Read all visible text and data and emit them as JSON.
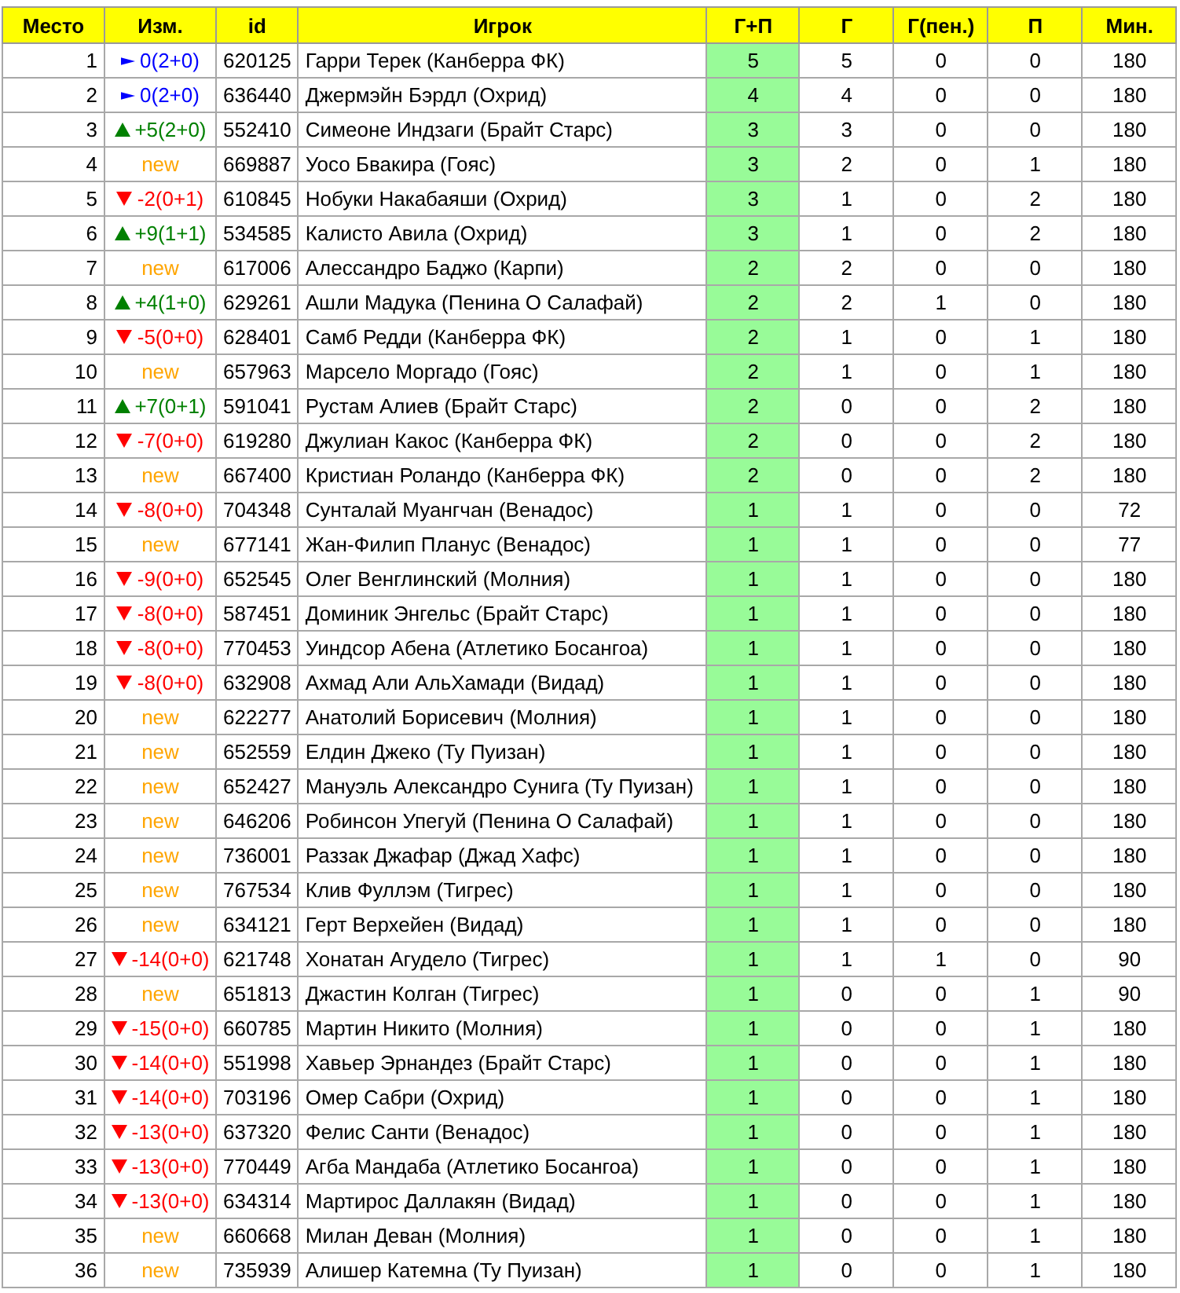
{
  "table": {
    "columns": [
      "Место",
      "Изм.",
      "id",
      "Игрок",
      "Г+П",
      "Г",
      "Г(пен.)",
      "П",
      "Мин."
    ],
    "rows": [
      {
        "place": "1",
        "change": {
          "kind": "same",
          "text": "0(2+0)"
        },
        "id": "620125",
        "player": "Гарри Терек (Канберра ФК)",
        "gp": "5",
        "g": "5",
        "pen": "0",
        "p": "0",
        "min": "180"
      },
      {
        "place": "2",
        "change": {
          "kind": "same",
          "text": "0(2+0)"
        },
        "id": "636440",
        "player": "Джермэйн Бэрдл (Охрид)",
        "gp": "4",
        "g": "4",
        "pen": "0",
        "p": "0",
        "min": "180"
      },
      {
        "place": "3",
        "change": {
          "kind": "up",
          "text": "+5(2+0)"
        },
        "id": "552410",
        "player": "Симеоне Индзаги (Брайт Старс)",
        "gp": "3",
        "g": "3",
        "pen": "0",
        "p": "0",
        "min": "180"
      },
      {
        "place": "4",
        "change": {
          "kind": "new",
          "text": "new"
        },
        "id": "669887",
        "player": "Уосо Бвакира (Гояс)",
        "gp": "3",
        "g": "2",
        "pen": "0",
        "p": "1",
        "min": "180"
      },
      {
        "place": "5",
        "change": {
          "kind": "down",
          "text": "-2(0+1)"
        },
        "id": "610845",
        "player": "Нобуки Накабаяши (Охрид)",
        "gp": "3",
        "g": "1",
        "pen": "0",
        "p": "2",
        "min": "180"
      },
      {
        "place": "6",
        "change": {
          "kind": "up",
          "text": "+9(1+1)"
        },
        "id": "534585",
        "player": "Калисто Авила (Охрид)",
        "gp": "3",
        "g": "1",
        "pen": "0",
        "p": "2",
        "min": "180"
      },
      {
        "place": "7",
        "change": {
          "kind": "new",
          "text": "new"
        },
        "id": "617006",
        "player": "Алессандро Баджо (Карпи)",
        "gp": "2",
        "g": "2",
        "pen": "0",
        "p": "0",
        "min": "180"
      },
      {
        "place": "8",
        "change": {
          "kind": "up",
          "text": "+4(1+0)"
        },
        "id": "629261",
        "player": "Ашли Мадука (Пенина О Салафай)",
        "gp": "2",
        "g": "2",
        "pen": "1",
        "p": "0",
        "min": "180"
      },
      {
        "place": "9",
        "change": {
          "kind": "down",
          "text": "-5(0+0)"
        },
        "id": "628401",
        "player": "Самб Редди (Канберра ФК)",
        "gp": "2",
        "g": "1",
        "pen": "0",
        "p": "1",
        "min": "180"
      },
      {
        "place": "10",
        "change": {
          "kind": "new",
          "text": "new"
        },
        "id": "657963",
        "player": "Марсело Моргадо (Гояс)",
        "gp": "2",
        "g": "1",
        "pen": "0",
        "p": "1",
        "min": "180"
      },
      {
        "place": "11",
        "change": {
          "kind": "up",
          "text": "+7(0+1)"
        },
        "id": "591041",
        "player": "Рустам Алиев (Брайт Старс)",
        "gp": "2",
        "g": "0",
        "pen": "0",
        "p": "2",
        "min": "180"
      },
      {
        "place": "12",
        "change": {
          "kind": "down",
          "text": "-7(0+0)"
        },
        "id": "619280",
        "player": "Джулиан Какос (Канберра ФК)",
        "gp": "2",
        "g": "0",
        "pen": "0",
        "p": "2",
        "min": "180"
      },
      {
        "place": "13",
        "change": {
          "kind": "new",
          "text": "new"
        },
        "id": "667400",
        "player": "Кристиан Роландо (Канберра ФК)",
        "gp": "2",
        "g": "0",
        "pen": "0",
        "p": "2",
        "min": "180"
      },
      {
        "place": "14",
        "change": {
          "kind": "down",
          "text": "-8(0+0)"
        },
        "id": "704348",
        "player": "Сунталай Муангчан (Венадос)",
        "gp": "1",
        "g": "1",
        "pen": "0",
        "p": "0",
        "min": "72"
      },
      {
        "place": "15",
        "change": {
          "kind": "new",
          "text": "new"
        },
        "id": "677141",
        "player": "Жан-Филип Планус (Венадос)",
        "gp": "1",
        "g": "1",
        "pen": "0",
        "p": "0",
        "min": "77"
      },
      {
        "place": "16",
        "change": {
          "kind": "down",
          "text": "-9(0+0)"
        },
        "id": "652545",
        "player": "Олег Венглинский (Молния)",
        "gp": "1",
        "g": "1",
        "pen": "0",
        "p": "0",
        "min": "180"
      },
      {
        "place": "17",
        "change": {
          "kind": "down",
          "text": "-8(0+0)"
        },
        "id": "587451",
        "player": "Доминик Энгельс (Брайт Старс)",
        "gp": "1",
        "g": "1",
        "pen": "0",
        "p": "0",
        "min": "180"
      },
      {
        "place": "18",
        "change": {
          "kind": "down",
          "text": "-8(0+0)"
        },
        "id": "770453",
        "player": "Уиндсор Абена (Атлетико Босангоа)",
        "gp": "1",
        "g": "1",
        "pen": "0",
        "p": "0",
        "min": "180"
      },
      {
        "place": "19",
        "change": {
          "kind": "down",
          "text": "-8(0+0)"
        },
        "id": "632908",
        "player": "Ахмад Али АльХамади (Видад)",
        "gp": "1",
        "g": "1",
        "pen": "0",
        "p": "0",
        "min": "180"
      },
      {
        "place": "20",
        "change": {
          "kind": "new",
          "text": "new"
        },
        "id": "622277",
        "player": "Анатолий Борисевич (Молния)",
        "gp": "1",
        "g": "1",
        "pen": "0",
        "p": "0",
        "min": "180"
      },
      {
        "place": "21",
        "change": {
          "kind": "new",
          "text": "new"
        },
        "id": "652559",
        "player": "Елдин Джеко (Ту Пуизан)",
        "gp": "1",
        "g": "1",
        "pen": "0",
        "p": "0",
        "min": "180"
      },
      {
        "place": "22",
        "change": {
          "kind": "new",
          "text": "new"
        },
        "id": "652427",
        "player": "Мануэль Александро Сунига (Ту Пуизан)",
        "gp": "1",
        "g": "1",
        "pen": "0",
        "p": "0",
        "min": "180"
      },
      {
        "place": "23",
        "change": {
          "kind": "new",
          "text": "new"
        },
        "id": "646206",
        "player": "Робинсон Упегуй (Пенина О Салафай)",
        "gp": "1",
        "g": "1",
        "pen": "0",
        "p": "0",
        "min": "180"
      },
      {
        "place": "24",
        "change": {
          "kind": "new",
          "text": "new"
        },
        "id": "736001",
        "player": "Раззак Джафар (Джад Хафс)",
        "gp": "1",
        "g": "1",
        "pen": "0",
        "p": "0",
        "min": "180"
      },
      {
        "place": "25",
        "change": {
          "kind": "new",
          "text": "new"
        },
        "id": "767534",
        "player": "Клив Фуллэм (Тигрес)",
        "gp": "1",
        "g": "1",
        "pen": "0",
        "p": "0",
        "min": "180"
      },
      {
        "place": "26",
        "change": {
          "kind": "new",
          "text": "new"
        },
        "id": "634121",
        "player": "Герт Верхейен (Видад)",
        "gp": "1",
        "g": "1",
        "pen": "0",
        "p": "0",
        "min": "180"
      },
      {
        "place": "27",
        "change": {
          "kind": "down",
          "text": "-14(0+0)"
        },
        "id": "621748",
        "player": "Хонатан Агудело (Тигрес)",
        "gp": "1",
        "g": "1",
        "pen": "1",
        "p": "0",
        "min": "90"
      },
      {
        "place": "28",
        "change": {
          "kind": "new",
          "text": "new"
        },
        "id": "651813",
        "player": "Джастин Колган (Тигрес)",
        "gp": "1",
        "g": "0",
        "pen": "0",
        "p": "1",
        "min": "90"
      },
      {
        "place": "29",
        "change": {
          "kind": "down",
          "text": "-15(0+0)"
        },
        "id": "660785",
        "player": "Мартин Никито (Молния)",
        "gp": "1",
        "g": "0",
        "pen": "0",
        "p": "1",
        "min": "180"
      },
      {
        "place": "30",
        "change": {
          "kind": "down",
          "text": "-14(0+0)"
        },
        "id": "551998",
        "player": "Хавьер Эрнандез (Брайт Старс)",
        "gp": "1",
        "g": "0",
        "pen": "0",
        "p": "1",
        "min": "180"
      },
      {
        "place": "31",
        "change": {
          "kind": "down",
          "text": "-14(0+0)"
        },
        "id": "703196",
        "player": "Омер Сабри (Охрид)",
        "gp": "1",
        "g": "0",
        "pen": "0",
        "p": "1",
        "min": "180"
      },
      {
        "place": "32",
        "change": {
          "kind": "down",
          "text": "-13(0+0)"
        },
        "id": "637320",
        "player": "Фелис Санти (Венадос)",
        "gp": "1",
        "g": "0",
        "pen": "0",
        "p": "1",
        "min": "180"
      },
      {
        "place": "33",
        "change": {
          "kind": "down",
          "text": "-13(0+0)"
        },
        "id": "770449",
        "player": "Агба Мандаба (Атлетико Босангоа)",
        "gp": "1",
        "g": "0",
        "pen": "0",
        "p": "1",
        "min": "180"
      },
      {
        "place": "34",
        "change": {
          "kind": "down",
          "text": "-13(0+0)"
        },
        "id": "634314",
        "player": "Мартирос Даллакян (Видад)",
        "gp": "1",
        "g": "0",
        "pen": "0",
        "p": "1",
        "min": "180"
      },
      {
        "place": "35",
        "change": {
          "kind": "new",
          "text": "new"
        },
        "id": "660668",
        "player": "Милан Деван (Молния)",
        "gp": "1",
        "g": "0",
        "pen": "0",
        "p": "1",
        "min": "180"
      },
      {
        "place": "36",
        "change": {
          "kind": "new",
          "text": "new"
        },
        "id": "735939",
        "player": "Алишер Катемна (Ту Пуизан)",
        "gp": "1",
        "g": "0",
        "pen": "0",
        "p": "1",
        "min": "180"
      }
    ]
  }
}
